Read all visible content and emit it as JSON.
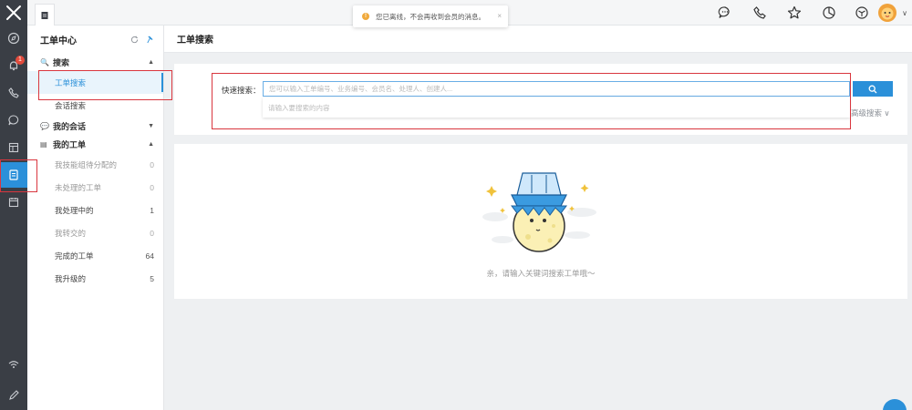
{
  "rail": {
    "items": [
      "compass-icon",
      "bell-icon",
      "phone-icon",
      "chat-icon",
      "calendar-grid-icon",
      "document-icon",
      "calendar-icon",
      "wifi-icon",
      "pencil-icon"
    ],
    "notification_badge": "1",
    "active_item": "document-icon"
  },
  "topbar": {
    "toast_text": "您已离线，不会再收到会员的消息。",
    "toast_close": "×",
    "icons": [
      "chat-icon",
      "phone-icon",
      "star-icon",
      "pie-chart-icon",
      "cube-icon",
      "avatar"
    ],
    "avatar_chevron": "∨"
  },
  "sidebar": {
    "title": "工单中心",
    "groups": [
      {
        "label": "搜索",
        "icon": "🔍",
        "expanded": true,
        "items": [
          {
            "label": "工单搜索",
            "active": true
          },
          {
            "label": "会话搜索"
          }
        ]
      },
      {
        "label": "我的会话",
        "icon": "💬",
        "expanded": false,
        "items": []
      },
      {
        "label": "我的工单",
        "icon": "▤",
        "expanded": true,
        "items": [
          {
            "label": "我技能组待分配的",
            "count": "0",
            "muted": true
          },
          {
            "label": "未处理的工单",
            "count": "0",
            "muted": true
          },
          {
            "label": "我处理中的",
            "count": "1",
            "muted": false
          },
          {
            "label": "我转交的",
            "count": "0",
            "muted": true
          },
          {
            "label": "完成的工单",
            "count": "64",
            "muted": false
          },
          {
            "label": "我升级的",
            "count": "5",
            "muted": false
          }
        ]
      }
    ]
  },
  "main": {
    "title": "工单搜索",
    "search_label": "快速搜索：",
    "search_placeholder": "您可以输入工单编号、业务编号、会员名、处理人、创建人...",
    "dropdown_hint": "请输入要搜索的内容",
    "advanced_search": "高级搜索 ∨",
    "empty_text": "亲，请输入关键词搜索工单哦～"
  },
  "colors": {
    "accent": "#2b90d9",
    "rail_bg": "#3a3e45",
    "annotation_red": "#d9363e"
  }
}
